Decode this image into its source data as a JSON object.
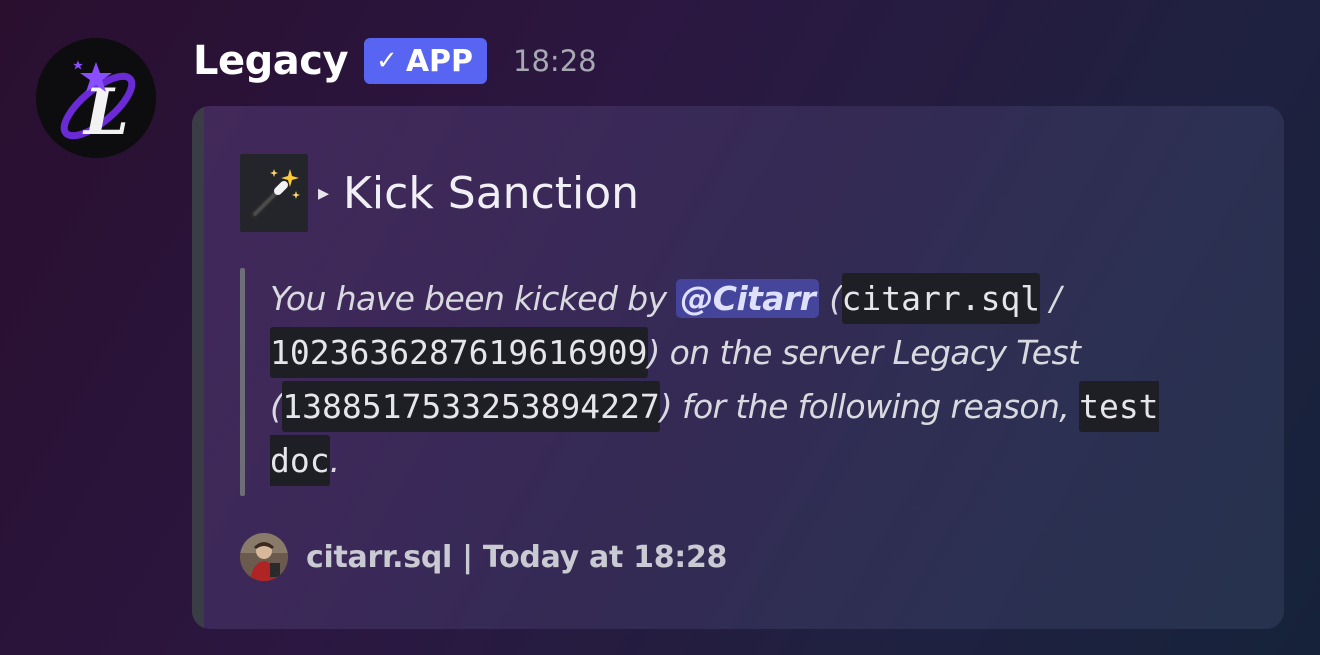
{
  "message": {
    "author": "Legacy",
    "badge_check": "✓",
    "badge_label": "APP",
    "timestamp": "18:28"
  },
  "embed": {
    "title_arrow": "▸",
    "title": "Kick Sanction",
    "description": {
      "part1": "You have been kicked by ",
      "mention": "@Citarr",
      "part2": " (",
      "code_username": "citarr.sql",
      "part3": " / ",
      "code_user_id": "1023636287619616909",
      "part4": ") on the server Legacy Test (",
      "code_server_id": "1388517533253894227",
      "part5": ") for the following reason, ",
      "code_reason": "test doc",
      "part6": "."
    },
    "footer_text": "citarr.sql | Today at 18:28"
  },
  "icons": {
    "author_avatar": "legacy-logo-icon",
    "title_emoji": "magic-wand-icon",
    "footer_avatar": "user-avatar-icon"
  },
  "colors": {
    "badge": "#5865f2",
    "mention_bg": "#5865f2",
    "embed_bar": "#3b3d46"
  }
}
